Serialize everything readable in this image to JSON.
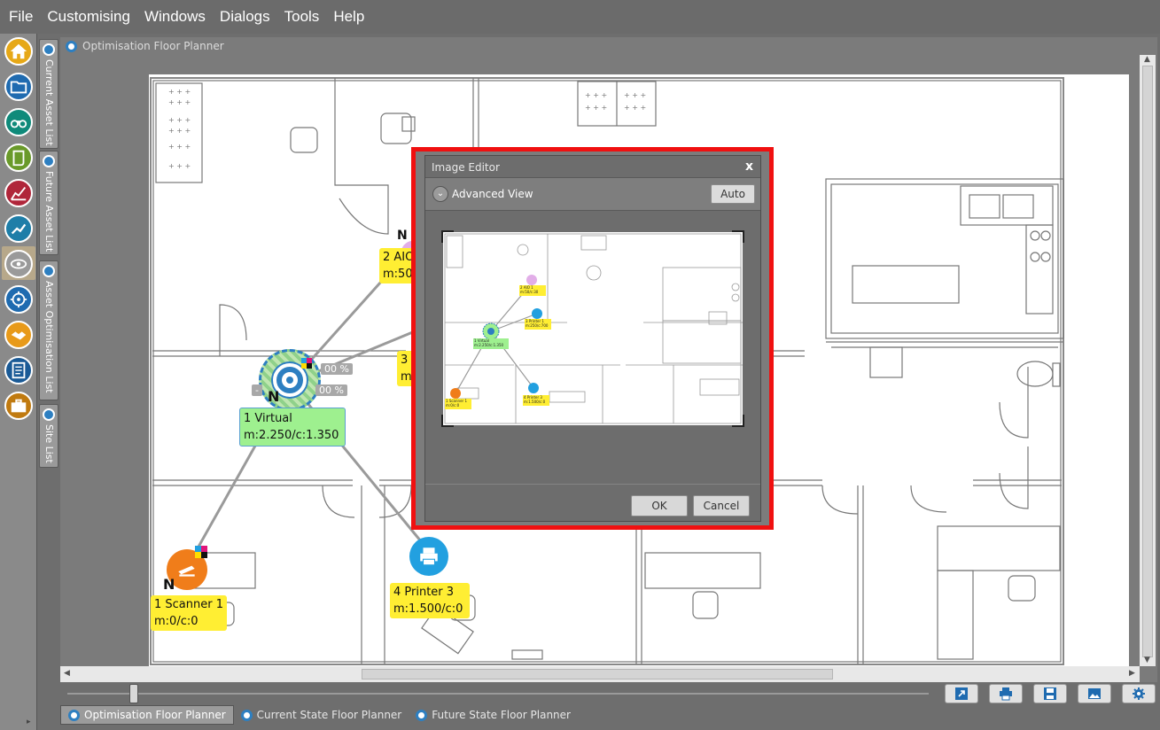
{
  "menu": [
    "File",
    "Customising",
    "Windows",
    "Dialogs",
    "Tools",
    "Help"
  ],
  "side_icons": [
    {
      "name": "home-icon",
      "color": "#e6a817"
    },
    {
      "name": "folder-icon",
      "color": "#1f6bb0"
    },
    {
      "name": "binoculars-icon",
      "color": "#0f8a7a"
    },
    {
      "name": "scroll-icon",
      "color": "#6a9a2a"
    },
    {
      "name": "chart-icon",
      "color": "#b0263a"
    },
    {
      "name": "trend-icon",
      "color": "#1e7ea8"
    },
    {
      "name": "eye-icon",
      "color": "#7a7a7a"
    },
    {
      "name": "target-icon",
      "color": "#1f6bb0"
    },
    {
      "name": "handshake-icon",
      "color": "#e89a1a"
    },
    {
      "name": "report-icon",
      "color": "#1a5a96"
    },
    {
      "name": "briefcase-icon",
      "color": "#c07a10"
    }
  ],
  "vertical_tabs": [
    "Current Asset List",
    "Future Asset List",
    "Asset Optimisation List",
    "Site List"
  ],
  "panel_title": "Optimisation Floor Planner",
  "devices": [
    {
      "label1": "1 Virtual",
      "label2": "m:2.250/c:1.350",
      "badge": "N"
    },
    {
      "label1": "2 AIO",
      "label2": "m:50",
      "badge": "N"
    },
    {
      "label1": "3",
      "label2": "m",
      "badge": ""
    },
    {
      "label1": "1 Scanner 1",
      "label2": "m:0/c:0",
      "badge": "N"
    },
    {
      "label1": "4 Printer 3",
      "label2": "m:1.500/c:0",
      "badge": ""
    }
  ],
  "percent_tags": [
    "00 %",
    "00 %",
    "-"
  ],
  "dialog": {
    "title": "Image Editor",
    "close": "x",
    "advanced_label": "Advanced View",
    "auto_label": "Auto",
    "ok_label": "OK",
    "cancel_label": "Cancel",
    "preview_labels": [
      "2 AIO 1",
      "m:50/c:30",
      "3 Printer 1",
      "m:250/c:700",
      "1 Virtual",
      "m:2.250/c:1.350",
      "1 Scanner 1",
      "m:0/c:0",
      "4 Printer 3",
      "m:1.500/c:0"
    ]
  },
  "bottom_tabs": [
    "Optimisation Floor Planner",
    "Current State Floor Planner",
    "Future State Floor Planner"
  ],
  "tool_buttons": [
    "expand-icon",
    "print-icon",
    "save-icon",
    "image-icon",
    "settings-icon"
  ],
  "colors": {
    "accent": "#2d7fc1",
    "highlight_frame": "#f01010",
    "label_yellow": "#ffee33",
    "label_green": "#9ef08f"
  }
}
